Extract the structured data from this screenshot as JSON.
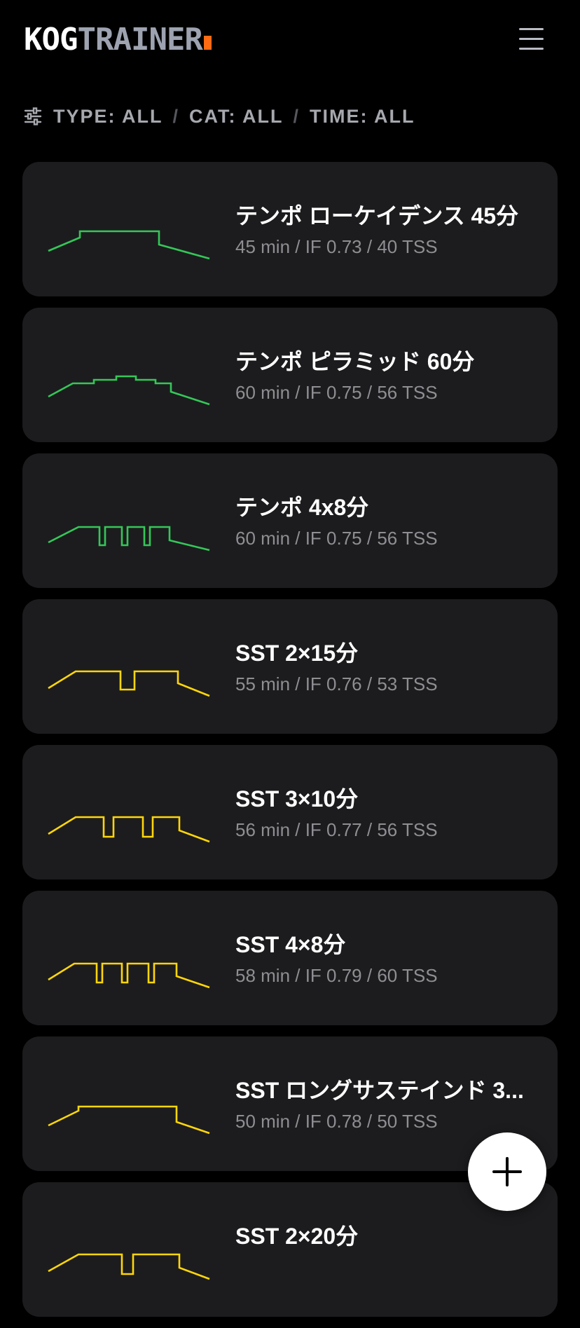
{
  "header": {
    "logo_part1": "KOG",
    "logo_part2": "TRAINER",
    "menu_icon": "hamburger-menu-icon"
  },
  "filters": {
    "icon": "sliders-filter-icon",
    "type": "TYPE: ALL",
    "category": "CAT: ALL",
    "time": "TIME: ALL",
    "separator": "/"
  },
  "colors": {
    "background": "#000000",
    "card": "#1c1c1e",
    "tempo": "#34c759",
    "sst": "#ffd60a",
    "accent": "#ff6a13",
    "secondary_text": "#8e8e93"
  },
  "workouts": [
    {
      "title": "テンポ ローケイデンス 45分",
      "stats": "45 min / IF 0.73 / 40 TSS",
      "category": "tempo"
    },
    {
      "title": "テンポ ピラミッド 60分",
      "stats": "60 min / IF 0.75 / 56 TSS",
      "category": "tempo"
    },
    {
      "title": "テンポ 4x8分",
      "stats": "60 min / IF 0.75 / 56 TSS",
      "category": "tempo"
    },
    {
      "title": "SST 2×15分",
      "stats": "55 min / IF 0.76 / 53 TSS",
      "category": "sst"
    },
    {
      "title": "SST 3×10分",
      "stats": "56 min / IF 0.77 / 56 TSS",
      "category": "sst"
    },
    {
      "title": "SST 4×8分",
      "stats": "58 min / IF 0.79 / 60 TSS",
      "category": "sst"
    },
    {
      "title": "SST ロングサステインド 3...",
      "stats": "50 min / IF 0.78 / 50 TSS",
      "category": "sst"
    },
    {
      "title": "SST 2×20分",
      "stats": "",
      "category": "sst"
    }
  ],
  "fab": {
    "icon": "plus-icon"
  }
}
